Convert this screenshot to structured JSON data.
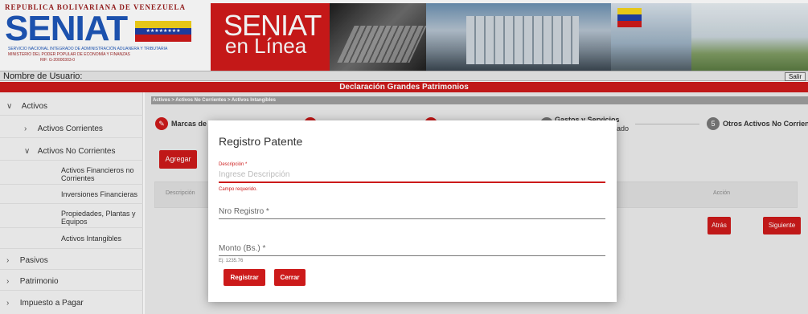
{
  "header": {
    "logo_top": "REPUBLICA BOLIVARIANA DE VENEZUELA",
    "logo_big": "SENIAT",
    "logo_sub1": "Servicio Nacional Integrado de Administración Aduanera y Tributaria",
    "logo_sub2": "Ministerio del Poder Popular de Economía y Finanzas",
    "logo_sub3": "RIF: G-20000303-0",
    "banner_title1": "SENIAT",
    "banner_title2": "en Línea",
    "colors": {
      "brand_blue": "#1e57b8",
      "brand_red": "#d11a1a"
    }
  },
  "userbar": {
    "label": "Nombre de Usuario:",
    "logout_label": "Salir"
  },
  "titlebar": {
    "title": "Declaración Grandes Patrimonios",
    "color": "#cc1a1a"
  },
  "sidebar": {
    "items": [
      {
        "label": "Activos",
        "chevron": "∨"
      },
      {
        "label": "Activos Corrientes",
        "chevron": "›"
      },
      {
        "label": "Activos No Corrientes",
        "chevron": "∨"
      },
      {
        "label": "Activos Financieros no Corrientes"
      },
      {
        "label": "Inversiones Financieras"
      },
      {
        "label": "Propiedades, Plantas y Equipos"
      },
      {
        "label": "Activos Intangibles"
      },
      {
        "label": "Pasivos",
        "chevron": "›"
      },
      {
        "label": "Patrimonio",
        "chevron": "›"
      },
      {
        "label": "Impuesto a Pagar",
        "chevron": "›"
      }
    ]
  },
  "main": {
    "breadcrumb": "Activos > Activos No Corrientes > Activos Intangibles",
    "steps": [
      {
        "label": "Marcas de Fá",
        "icon": "✎"
      },
      {
        "label": "ado",
        "icon": ""
      },
      {
        "label": "Gastos y Servicios",
        "icon": ""
      },
      {
        "label": "Otros Activos No Corrientes",
        "icon": "5"
      }
    ],
    "add_label": "Agregar",
    "table_headers": [
      "Descripción",
      "Acción"
    ],
    "back_label": "Atrás",
    "next_label": "Siguiente"
  },
  "modal": {
    "title": "Registro Patente",
    "field1": {
      "label": "Descripción *",
      "placeholder": "Ingrese Descripción",
      "error": "Campo requerido."
    },
    "field2": {
      "label": "Nro Registro *"
    },
    "field3": {
      "label": "Monto (Bs.) *",
      "hint": "Ej: 1235.76"
    },
    "register_label": "Registrar",
    "close_label": "Cerrar"
  }
}
